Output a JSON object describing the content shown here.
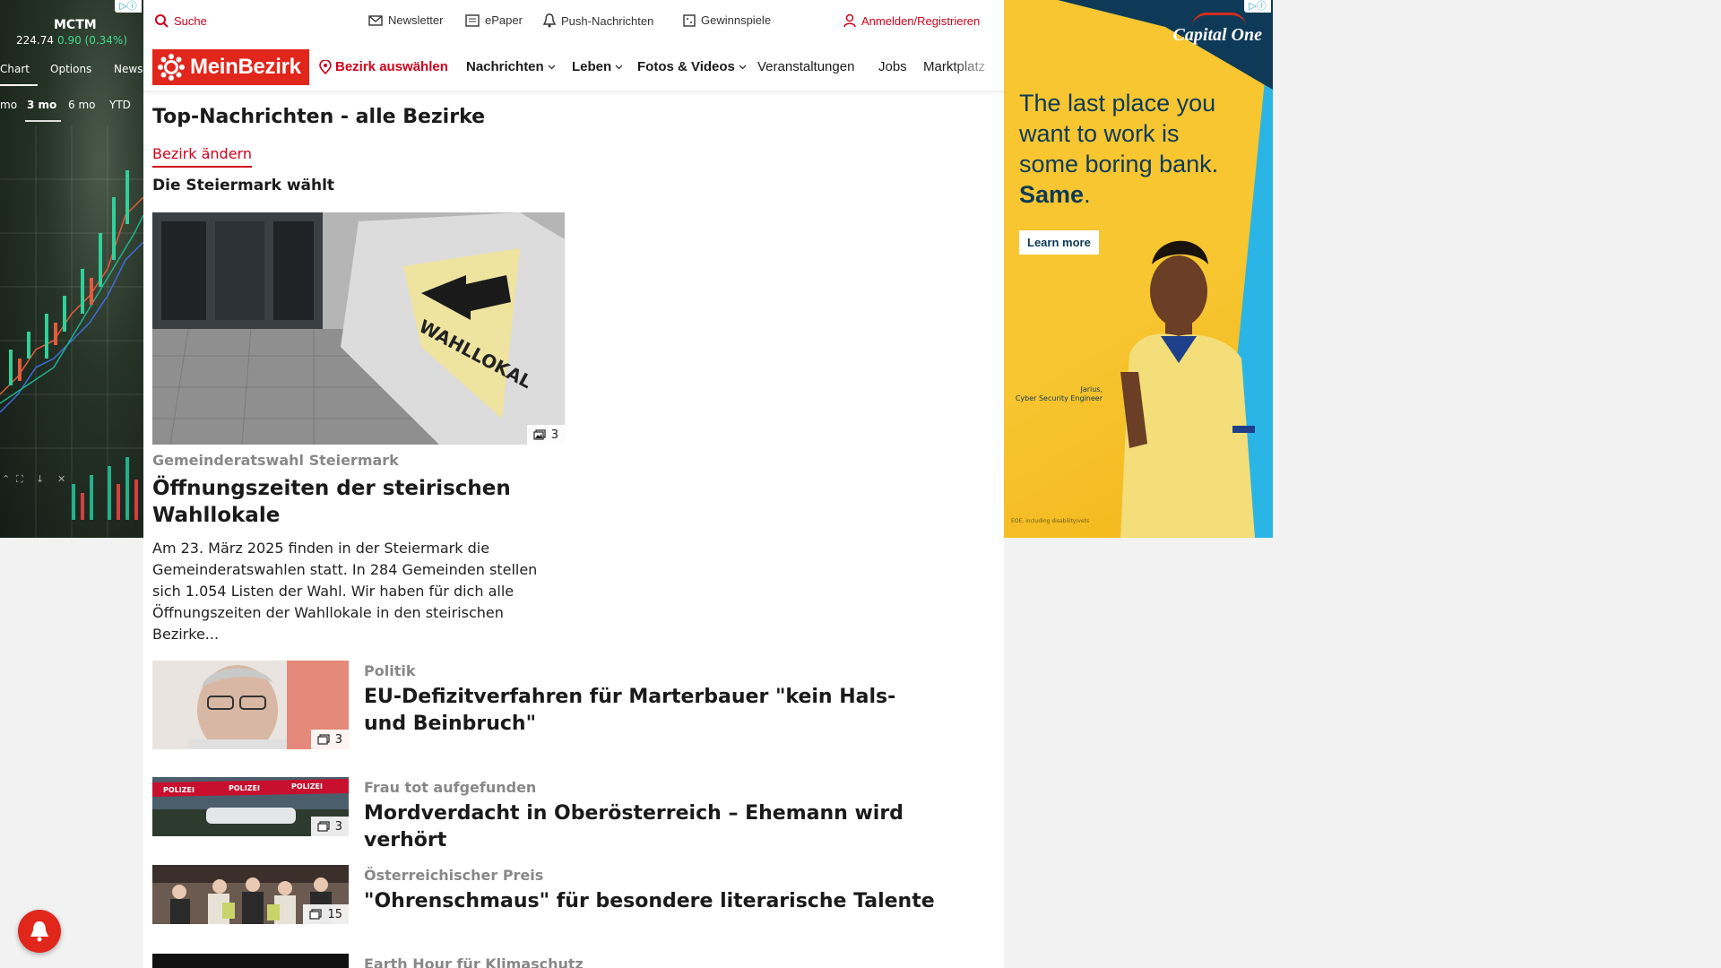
{
  "left_ad": {
    "badge": "▷ⓘ",
    "ticker": "MCTM",
    "price": "224.74",
    "change": "0.90 (0.34%)",
    "tabs": [
      "Chart",
      "Options",
      "News"
    ],
    "ranges": [
      "mo",
      "3 mo",
      "6 mo",
      "YTD"
    ],
    "active_range": "3 mo"
  },
  "topbar": {
    "search": "Suche",
    "newsletter": "Newsletter",
    "epaper": "ePaper",
    "push": "Push-Nachrichten",
    "contests": "Gewinnspiele",
    "login": "Anmelden/Registrieren"
  },
  "nav": {
    "logo": "MeinBezirk",
    "district": "Bezirk auswählen",
    "items": [
      "Nachrichten",
      "Leben",
      "Fotos & Videos",
      "Veranstaltungen",
      "Jobs",
      "Marktplatz"
    ]
  },
  "main": {
    "page_title": "Top-Nachrichten - alle Bezirke",
    "change_district": "Bezirk ändern",
    "section_title": "Die Steiermark wählt",
    "lead": {
      "image_label": "WAHLLOKAL",
      "image_count": "3",
      "kicker": "Gemeinderatswahl Steiermark",
      "title": "Öffnungszeiten der steirischen Wahllokale",
      "teaser": "Am 23. März 2025 finden in der Steiermark die Gemeinderatswahlen statt. In 284 Gemeinden stellen sich 1.054 Listen der Wahl. Wir haben für dich alle Öffnungszeiten der Wahllokale in den steirischen Bezirke..."
    },
    "articles": [
      {
        "kicker": "Politik",
        "title": "EU-Defizitverfahren für Marterbauer \"kein Hals- und Beinbruch\"",
        "image_count": "3"
      },
      {
        "kicker": "Frau tot aufgefunden",
        "title": "Mordverdacht in Oberösterreich – Ehemann wird verhört",
        "image_count": "3",
        "image_text": "POLIZEI"
      },
      {
        "kicker": "Österreichischer Preis",
        "title": "\"Ohrenschmaus\" für besondere literarische Talente",
        "image_count": "15"
      },
      {
        "kicker": "Earth Hour für Klimaschutz",
        "title": "",
        "image_count": ""
      }
    ]
  },
  "right_ad": {
    "badge": "▷ⓘ",
    "brand": "Capital One",
    "headline": "The last place you want to work is some boring bank.",
    "headline_emphasis": "Same",
    "cta": "Learn more",
    "person_name": "Jarius,",
    "person_role": "Cyber Security Engineer",
    "fine_print": "EOE, including disability/vets"
  },
  "colors": {
    "brand_red": "#e1261c",
    "link_red": "#d0021b",
    "ad_yellow": "#f7c631",
    "ad_navy": "#0e3a57",
    "ad_blue": "#2bb5e6"
  },
  "icons": [
    "search-icon",
    "mail-icon",
    "newspaper-icon",
    "bell-icon",
    "gift-icon",
    "user-icon",
    "map-pin-icon",
    "chevron-down-icon",
    "images-icon",
    "notification-bell-icon"
  ]
}
